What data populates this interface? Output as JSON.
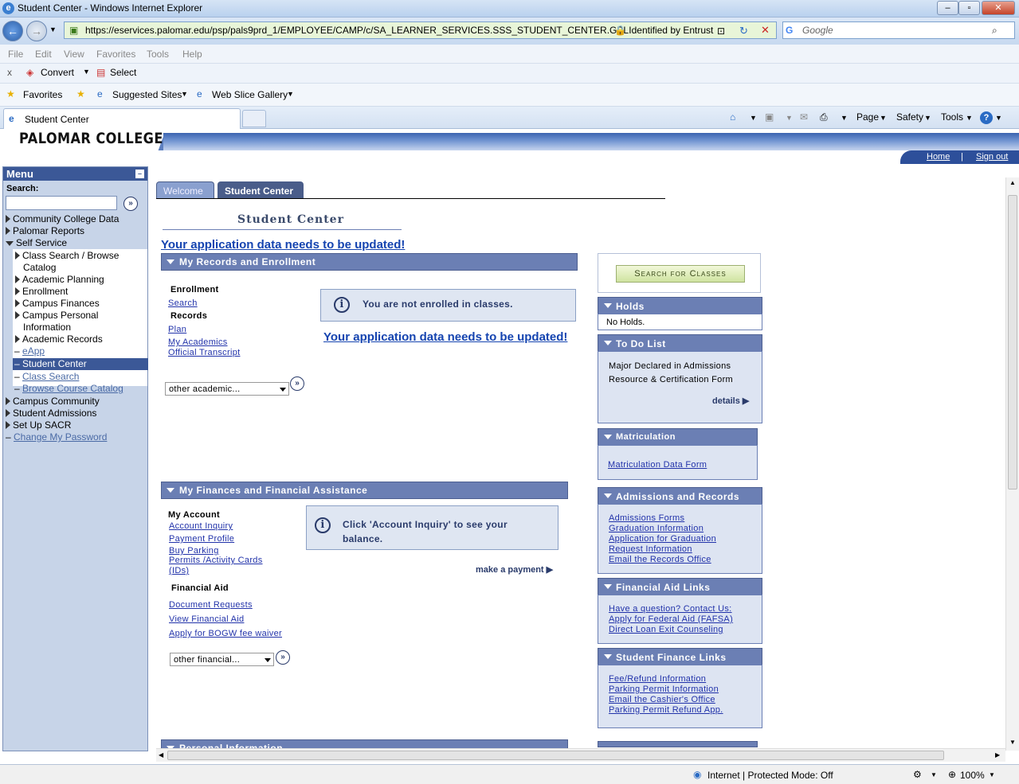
{
  "window": {
    "title": "Student Center - Windows Internet Explorer"
  },
  "address": {
    "url": "https://eservices.palomar.edu/psp/pals9prd_1/EMPLOYEE/CAMP/c/SA_LEARNER_SERVICES.SSS_STUDENT_CENTER.GBL",
    "security": "Identified by Entrust"
  },
  "search": {
    "placeholder": "Google"
  },
  "menubar": [
    "File",
    "Edit",
    "View",
    "Favorites",
    "Tools",
    "Help"
  ],
  "cmdbar": {
    "convert": "Convert",
    "select": "Select"
  },
  "favbar": {
    "favorites": "Favorites",
    "suggested": "Suggested Sites",
    "webslice": "Web Slice Gallery"
  },
  "tab": {
    "label": "Student Center"
  },
  "commandbar": {
    "page": "Page",
    "safety": "Safety",
    "tools": "Tools"
  },
  "site": {
    "logo": "PALOMAR COLLEGE",
    "home": "Home",
    "signout": "Sign out"
  },
  "leftmenu": {
    "title": "Menu",
    "search_label": "Search:",
    "items": [
      "Community College Data",
      "Palomar Reports",
      "Self Service",
      "Class Search / Browse",
      "Catalog",
      "Academic Planning",
      "Enrollment",
      "Campus Finances",
      "Campus Personal",
      "Information",
      "Academic Records",
      "eApp",
      "Student Center",
      "Class Search",
      "Browse Course Catalog",
      "Campus Community",
      "Student Admissions",
      "Set Up SACR",
      "Change My Password"
    ]
  },
  "pagetabs": {
    "welcome": "Welcome",
    "student_center": "Student Center"
  },
  "page": {
    "title": "Student Center",
    "alert": "Your application data needs to be updated!",
    "records": {
      "header": "My Records and Enrollment",
      "enrollment": "Enrollment",
      "search": "Search",
      "records": "Records",
      "plan": "Plan",
      "my_academics": "My Academics",
      "transcript": "Official Transcript",
      "info": "You are not enrolled in classes.",
      "alert2": "Your application data needs to be updated!",
      "dropdown": "other academic..."
    },
    "finances": {
      "header": "My Finances and Financial Assistance",
      "my_account": "My Account",
      "account_inquiry": "Account Inquiry",
      "payment_profile": "Payment Profile",
      "buy_parking": "Buy Parking",
      "permits": "Permits /Activity Cards",
      "ids": "(IDs)",
      "info_line1": "Click 'Account Inquiry' to see your",
      "info_line2": "balance.",
      "make_payment": "make a payment",
      "financial_aid": "Financial Aid",
      "doc_requests": "Document Requests",
      "view_aid": "View Financial Aid",
      "bogw": "Apply for BOGW fee waiver",
      "dropdown": "other financial..."
    },
    "personal": {
      "header": "Personal Information"
    }
  },
  "rightcol": {
    "search_button": "Search for Classes",
    "holds": {
      "title": "Holds",
      "text": "No Holds."
    },
    "todo": {
      "title": "To Do List",
      "line1": "Major Declared in Admissions",
      "line2": "Resource & Certification Form",
      "details": "details"
    },
    "matric": {
      "title": "Matriculation",
      "link": "Matriculation Data Form"
    },
    "admissions": {
      "title": "Admissions and Records",
      "links": [
        "Admissions Forms",
        "Graduation Information",
        "Application for Graduation",
        "Request Information",
        "Email the Records Office"
      ]
    },
    "finaid": {
      "title": "Financial Aid Links",
      "links": [
        "Have a question? Contact Us:",
        "Apply for Federal Aid (FAFSA)",
        "Direct Loan Exit Counseling"
      ]
    },
    "studfin": {
      "title": "Student Finance Links",
      "links": [
        "Fee/Refund Information",
        "Parking Permit Information",
        "Email the Cashier's Office",
        "Parking Permit Refund App."
      ]
    }
  },
  "status": {
    "zone": "Internet | Protected Mode: Off",
    "zoom": "100%"
  }
}
